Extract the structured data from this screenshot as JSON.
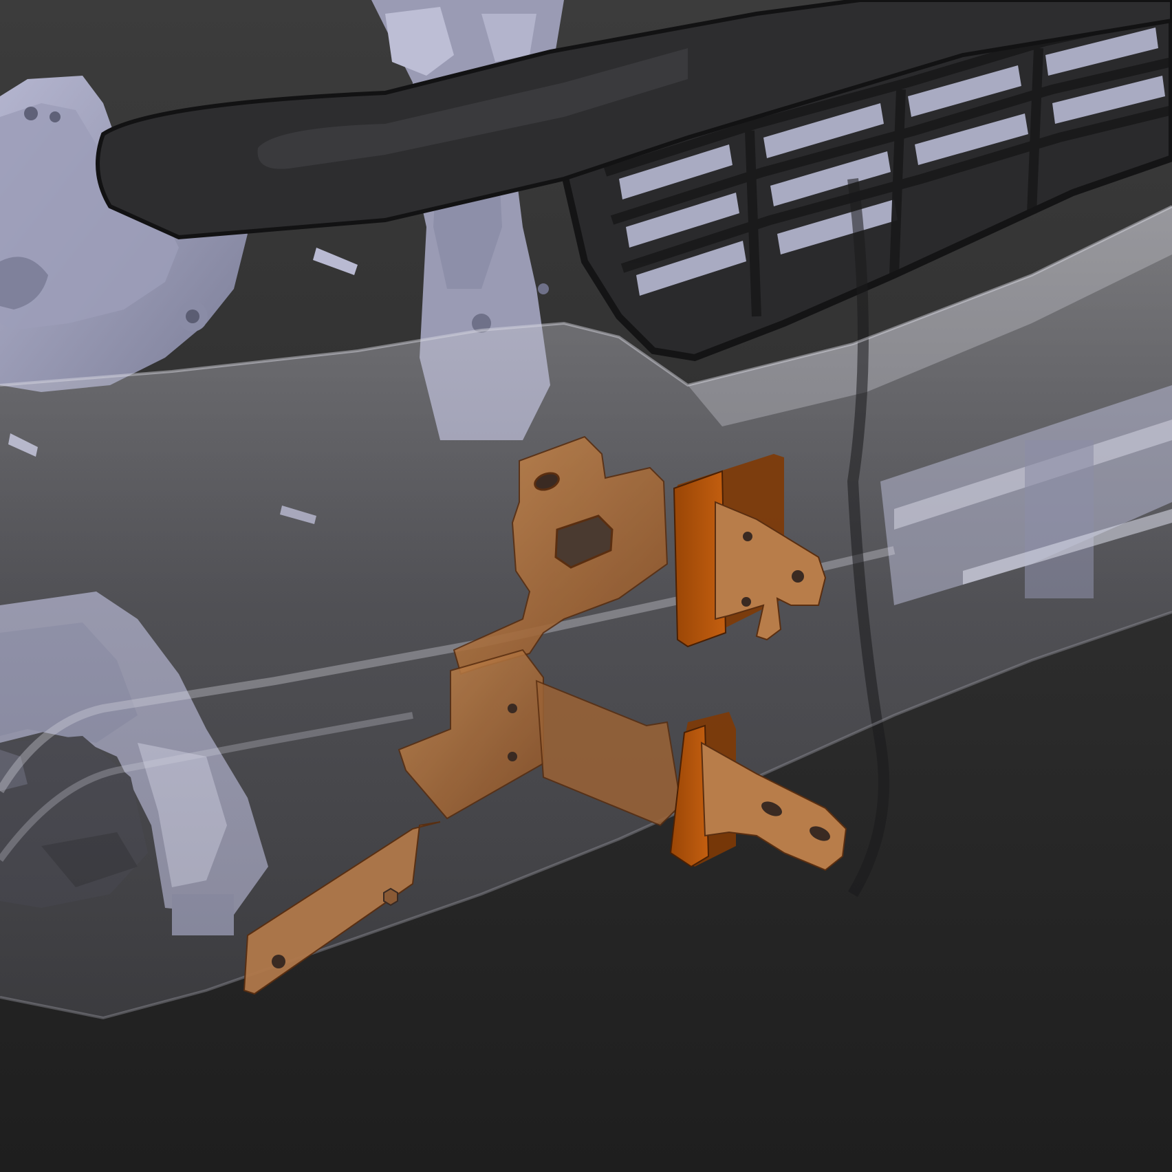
{
  "scene": {
    "description_visible_text": "",
    "background_top": "#3b3b3b",
    "background_bottom": "#1e1e1e",
    "structure_color": "#a9aac4",
    "structure_dark": "#6f7189",
    "bumper_glass": "#c8c8d0",
    "grille_color": "#2b2b2d",
    "grille_edge": "#161617",
    "bracket_color": "#b3703a",
    "bracket_light": "#d08a4f",
    "bracket_dark": "#7a3a0c"
  },
  "parts": [
    {
      "name": "vehicle-frame-structure",
      "icon": "frame-structure"
    },
    {
      "name": "front-grille",
      "icon": "grille"
    },
    {
      "name": "front-bumper-cover",
      "icon": "bumper-transparent"
    },
    {
      "name": "upper-mounting-bracket",
      "icon": "bracket"
    },
    {
      "name": "lower-mounting-bracket",
      "icon": "bracket"
    }
  ]
}
